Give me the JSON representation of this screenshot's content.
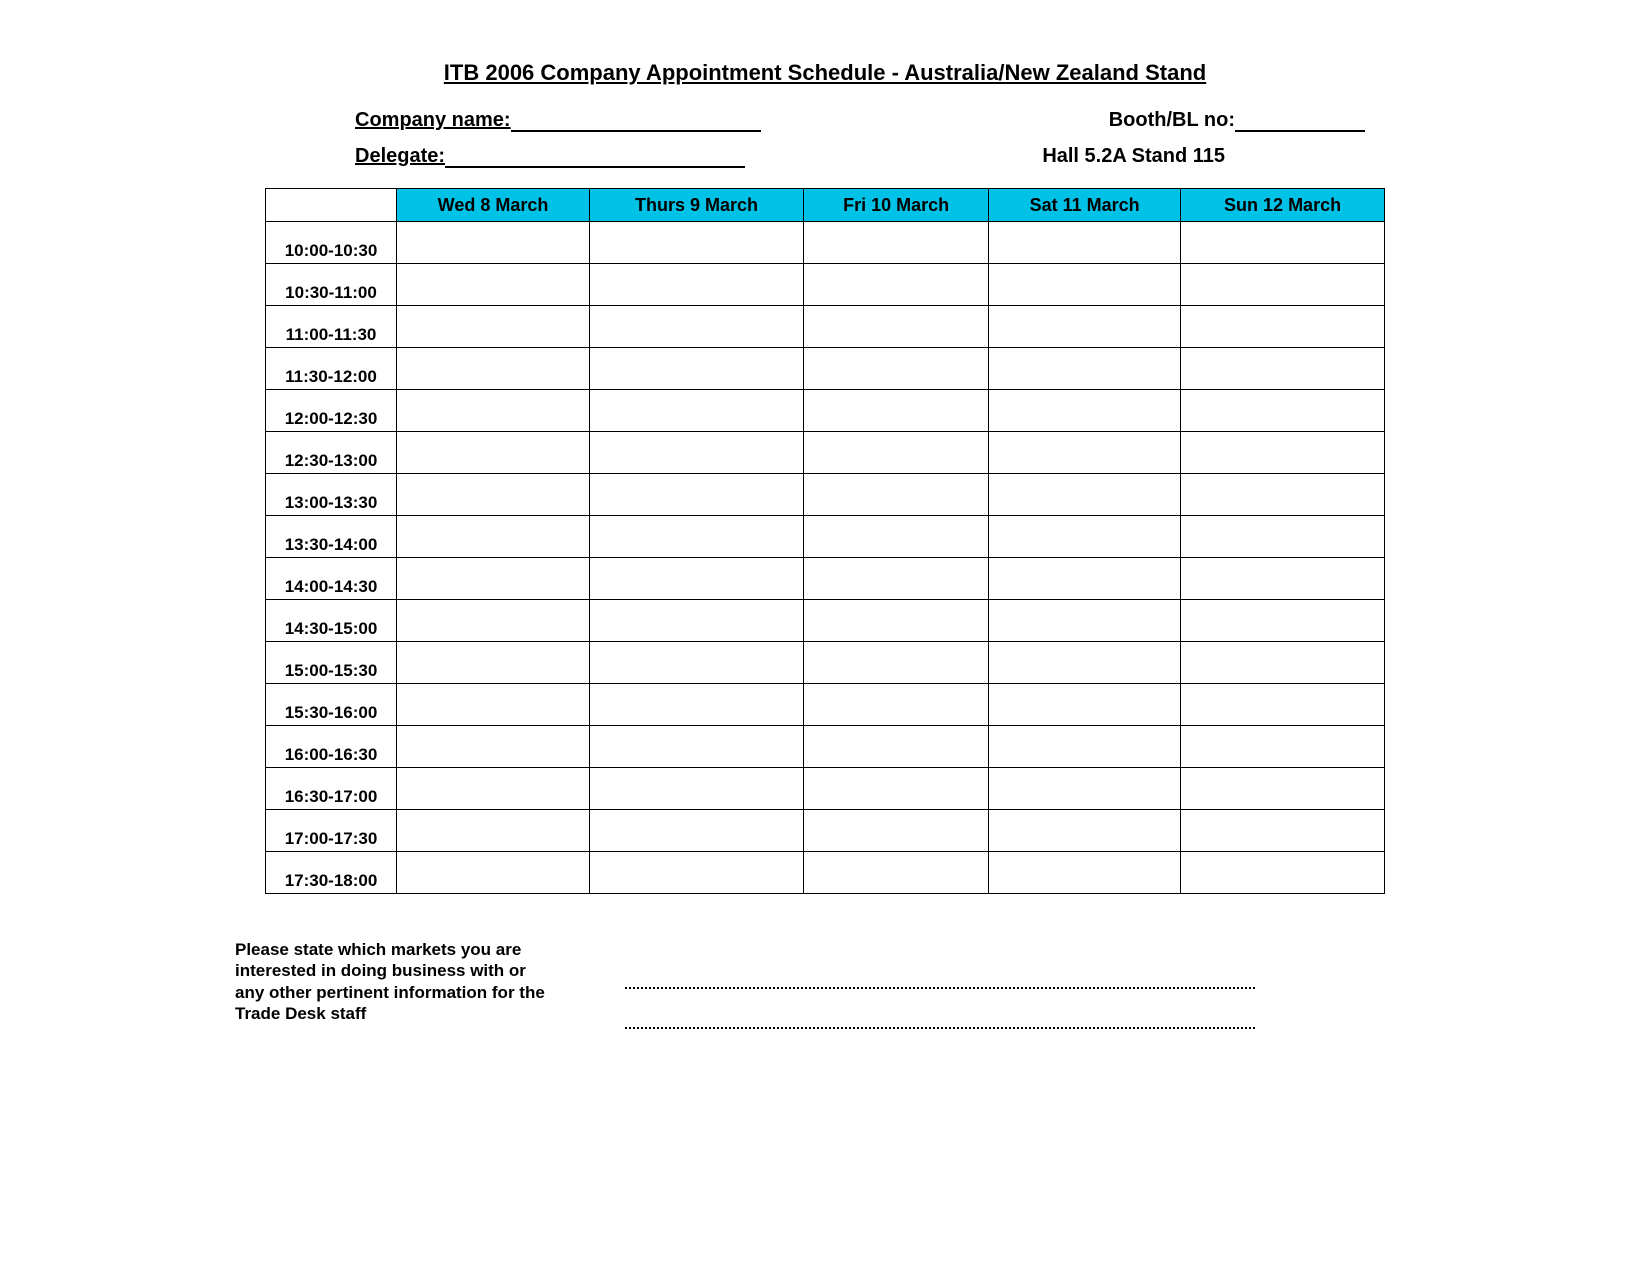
{
  "title": "ITB 2006 Company Appointment Schedule - Australia/New Zealand Stand",
  "fields": {
    "company_label": "Company name:",
    "delegate_label": "Delegate:",
    "booth_label": "Booth/BL no:",
    "hall_stand": "Hall 5.2A Stand 115"
  },
  "days": [
    "Wed 8 March",
    "Thurs 9 March",
    "Fri 10 March",
    "Sat 11 March",
    "Sun 12 March"
  ],
  "timeslots": [
    "10:00-10:30",
    "10:30-11:00",
    "11:00-11:30",
    "11:30-12:00",
    "12:00-12:30",
    "12:30-13:00",
    "13:00-13:30",
    "13:30-14:00",
    "14:00-14:30",
    "14:30-15:00",
    "15:00-15:30",
    "15:30-16:00",
    "16:00-16:30",
    "16:30-17:00",
    "17:00-17:30",
    "17:30-18:00"
  ],
  "footer_note": "Please state which markets you are interested in doing business with or any other pertinent information for the Trade Desk staff"
}
